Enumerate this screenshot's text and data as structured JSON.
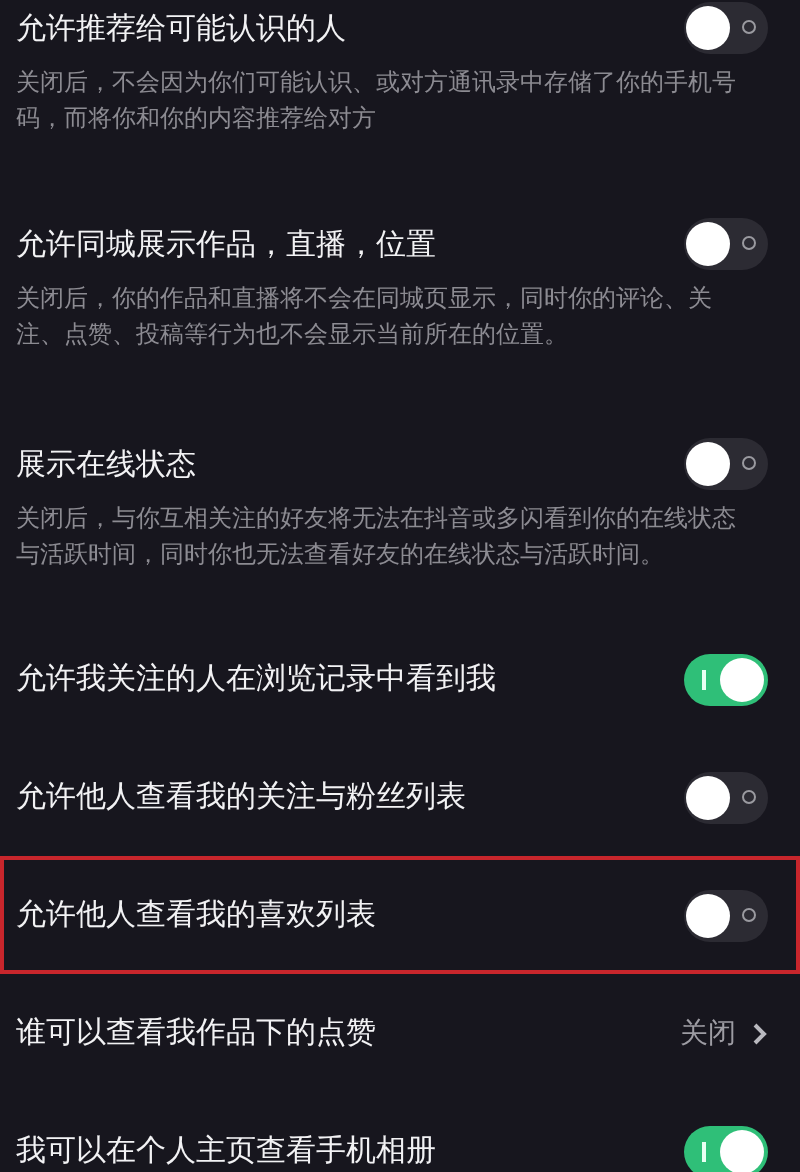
{
  "settings": [
    {
      "kind": "toggle",
      "title": "允许推荐给可能认识的人",
      "description": "关闭后，不会因为你们可能认识、或对方通讯录中存储了你的手机号码，而将你和你的内容推荐给对方",
      "on": false,
      "highlighted": false
    },
    {
      "kind": "toggle",
      "title": "允许同城展示作品，直播，位置",
      "description": "关闭后，你的作品和直播将不会在同城页显示，同时你的评论、关注、点赞、投稿等行为也不会显示当前所在的位置。",
      "on": false,
      "highlighted": false
    },
    {
      "kind": "toggle",
      "title": "展示在线状态",
      "description": "关闭后，与你互相关注的好友将无法在抖音或多闪看到你的在线状态与活跃时间，同时你也无法查看好友的在线状态与活跃时间。",
      "on": false,
      "highlighted": false
    },
    {
      "kind": "toggle",
      "title": "允许我关注的人在浏览记录中看到我",
      "on": true,
      "highlighted": false
    },
    {
      "kind": "toggle",
      "title": "允许他人查看我的关注与粉丝列表",
      "on": false,
      "highlighted": false
    },
    {
      "kind": "toggle",
      "title": "允许他人查看我的喜欢列表",
      "on": false,
      "highlighted": true
    },
    {
      "kind": "link",
      "title": "谁可以查看我作品下的点赞",
      "value": "关闭",
      "highlighted": false
    },
    {
      "kind": "toggle",
      "title": "我可以在个人主页查看手机相册",
      "on": true,
      "highlighted": false
    }
  ]
}
